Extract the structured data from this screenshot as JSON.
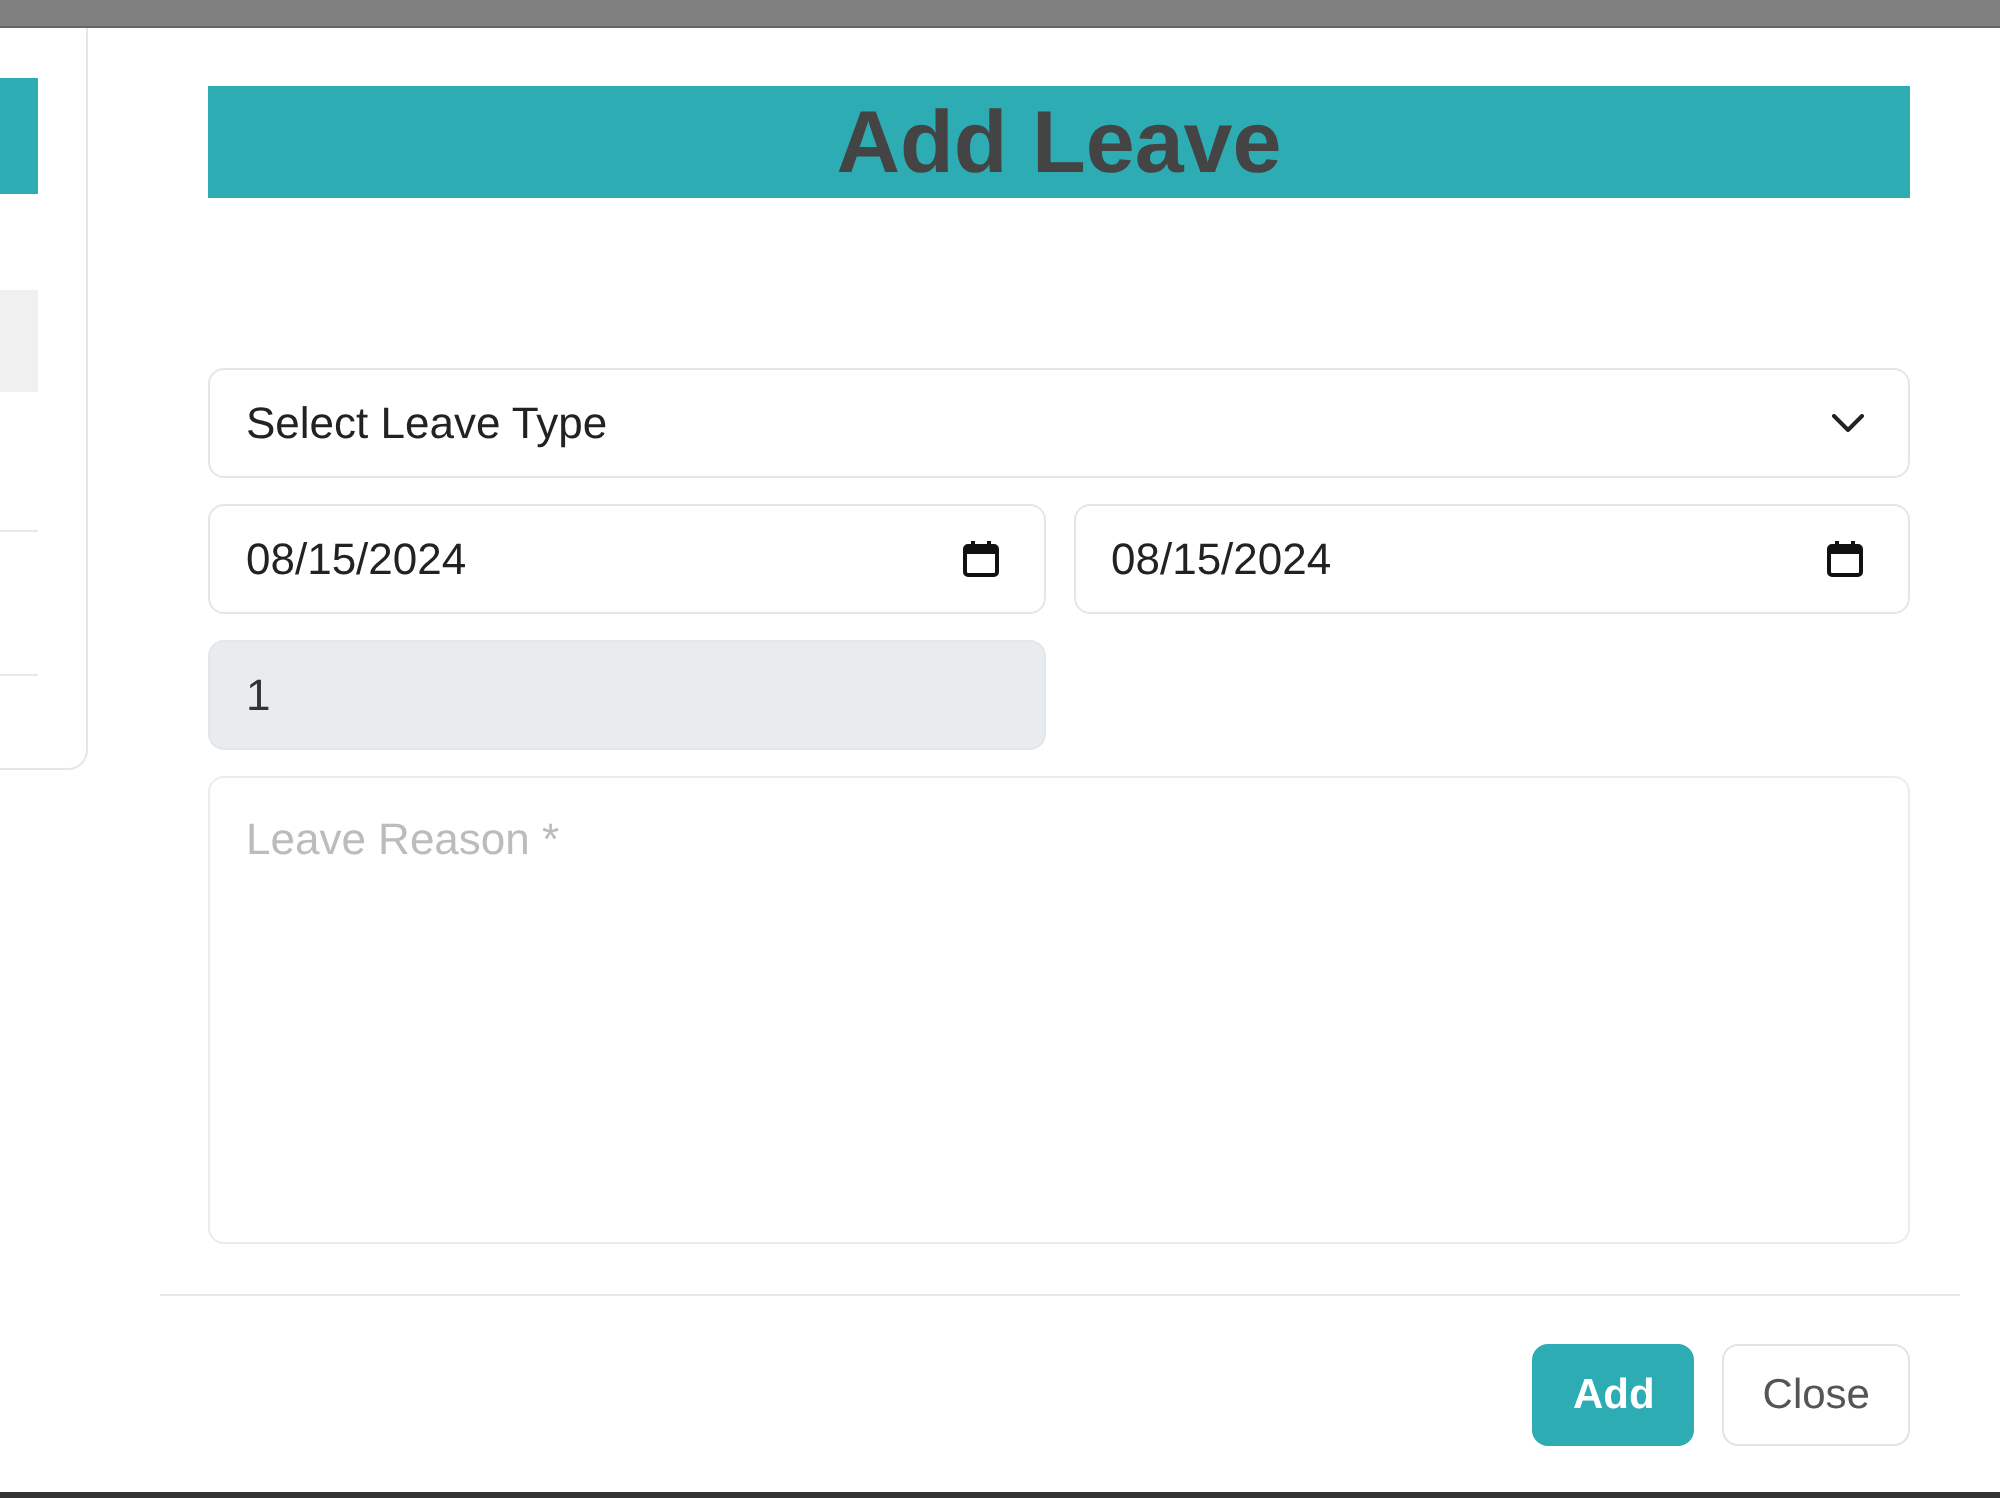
{
  "dialog": {
    "title": "Add Leave"
  },
  "leave_type": {
    "value": "Select Leave Type"
  },
  "dates": [
    {
      "value": "08/15/2024"
    },
    {
      "value": "08/15/2024"
    }
  ],
  "days": {
    "value": "1",
    "disabled": true
  },
  "reason": {
    "placeholder": "Leave Reason *"
  },
  "buttons": [
    {
      "label": "Add",
      "kind": "primary"
    },
    {
      "label": "Close",
      "kind": "secondary"
    }
  ]
}
